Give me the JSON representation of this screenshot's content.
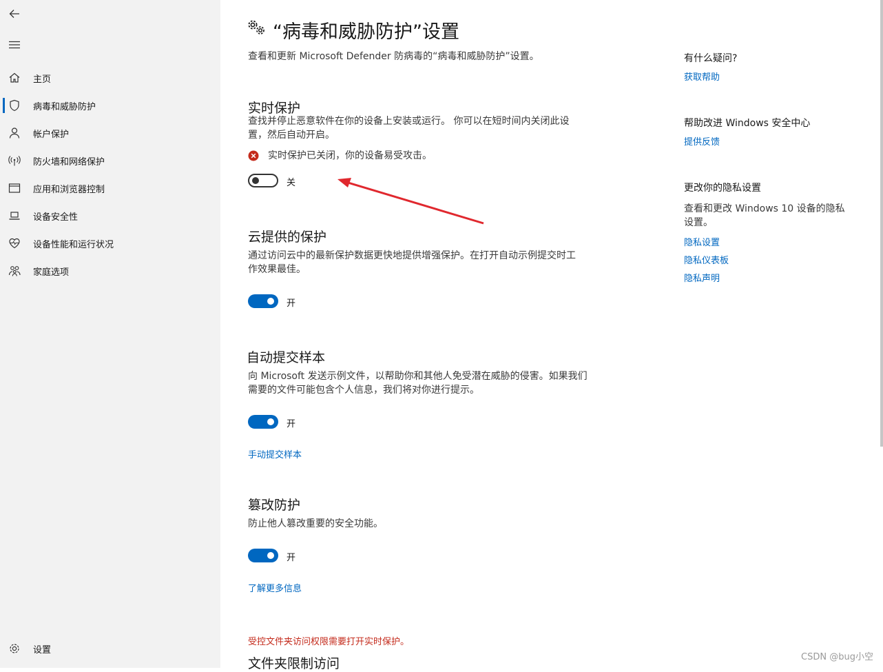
{
  "sidebar": {
    "back_icon": "back-arrow-icon",
    "menu_icon": "hamburger-icon",
    "items": [
      {
        "label": "主页",
        "icon": "home-icon"
      },
      {
        "label": "病毒和威胁防护",
        "icon": "shield-icon",
        "active": true
      },
      {
        "label": "帐户保护",
        "icon": "person-icon"
      },
      {
        "label": "防火墙和网络保护",
        "icon": "antenna-icon"
      },
      {
        "label": "应用和浏览器控制",
        "icon": "window-icon"
      },
      {
        "label": "设备安全性",
        "icon": "laptop-icon"
      },
      {
        "label": "设备性能和运行状况",
        "icon": "heart-icon"
      },
      {
        "label": "家庭选项",
        "icon": "family-icon"
      }
    ],
    "settings_label": "设置"
  },
  "header": {
    "title": "“病毒和威胁防护”设置",
    "description": "查看和更新 Microsoft Defender 防病毒的“病毒和威胁防护”设置。"
  },
  "sections": {
    "realtime": {
      "title": "实时保护",
      "description": "查找并停止恶意软件在你的设备上安装或运行。 你可以在短时间内关闭此设置，然后自动开启。",
      "warning": "实时保护已关闭，你的设备易受攻击。",
      "toggle_label": "关",
      "enabled": false
    },
    "cloud": {
      "title": "云提供的保护",
      "description": "通过访问云中的最新保护数据更快地提供增强保护。在打开自动示例提交时工作效果最佳。",
      "toggle_label": "开",
      "enabled": true
    },
    "sample": {
      "title": "自动提交样本",
      "description": "向 Microsoft 发送示例文件，以帮助你和其他人免受潜在威胁的侵害。如果我们需要的文件可能包含个人信息，我们将对你进行提示。",
      "toggle_label": "开",
      "enabled": true,
      "link": "手动提交样本"
    },
    "tamper": {
      "title": "篡改防护",
      "description": "防止他人篡改重要的安全功能。",
      "toggle_label": "开",
      "enabled": true,
      "link": "了解更多信息"
    },
    "folder": {
      "warning": "受控文件夹访问权限需要打开实时保护。",
      "title": "文件夹限制访问"
    }
  },
  "right_panel": {
    "help_title": "有什么疑问?",
    "help_link": "获取帮助",
    "improve_title": "帮助改进 Windows 安全中心",
    "improve_link": "提供反馈",
    "privacy_title": "更改你的隐私设置",
    "privacy_desc": "查看和更改 Windows 10 设备的隐私设置。",
    "privacy_links": [
      "隐私设置",
      "隐私仪表板",
      "隐私声明"
    ]
  },
  "watermark": "CSDN @bug小空",
  "colors": {
    "accent": "#0067c0",
    "error": "#c42b1c",
    "annotation_arrow": "#e0282e"
  }
}
